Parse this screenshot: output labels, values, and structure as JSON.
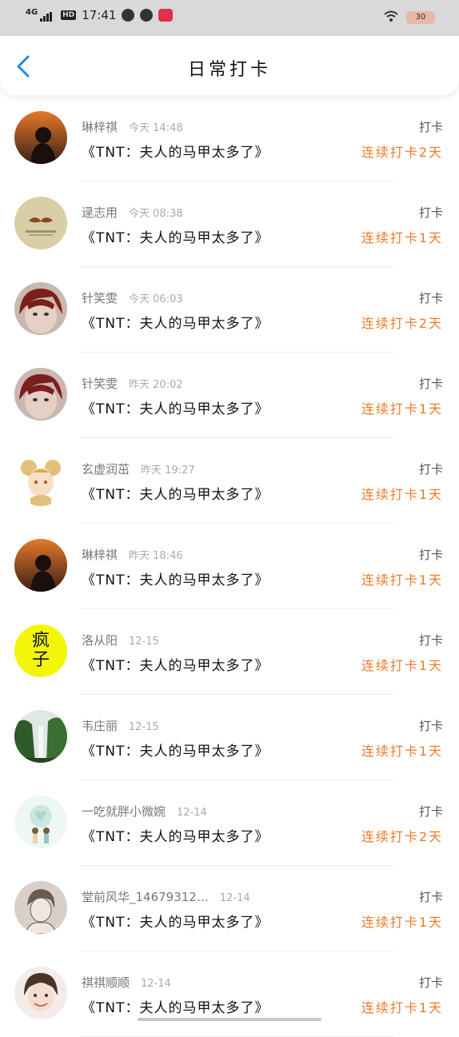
{
  "status_bar": {
    "network": "4G",
    "hd": "HD",
    "time": "17:41",
    "battery": "30"
  },
  "header": {
    "title": "日常打卡",
    "back_icon": "chevron-left-icon"
  },
  "colors": {
    "accent": "#1e88e5",
    "streak": "#f07a28"
  },
  "entries": [
    {
      "name": "琳梓祺",
      "time": "今天 14:48",
      "book": "《TNT：夫人的马甲太多了》",
      "label": "打卡",
      "streak": "连续打卡2天"
    },
    {
      "name": "逯志用",
      "time": "今天 08:38",
      "book": "《TNT：夫人的马甲太多了》",
      "label": "打卡",
      "streak": "连续打卡1天"
    },
    {
      "name": "针笑雯",
      "time": "今天 06:03",
      "book": "《TNT：夫人的马甲太多了》",
      "label": "打卡",
      "streak": "连续打卡2天"
    },
    {
      "name": "针笑雯",
      "time": "昨天 20:02",
      "book": "《TNT：夫人的马甲太多了》",
      "label": "打卡",
      "streak": "连续打卡1天"
    },
    {
      "name": "玄虚润茁",
      "time": "昨天 19:27",
      "book": "《TNT：夫人的马甲太多了》",
      "label": "打卡",
      "streak": "连续打卡1天"
    },
    {
      "name": "琳梓祺",
      "time": "昨天 18:46",
      "book": "《TNT：夫人的马甲太多了》",
      "label": "打卡",
      "streak": "连续打卡1天"
    },
    {
      "name": "洛从阳",
      "time": "12-15",
      "book": "《TNT：夫人的马甲太多了》",
      "label": "打卡",
      "streak": "连续打卡1天"
    },
    {
      "name": "韦庄丽",
      "time": "12-15",
      "book": "《TNT：夫人的马甲太多了》",
      "label": "打卡",
      "streak": "连续打卡1天"
    },
    {
      "name": "一吃就胖小微婉",
      "time": "12-14",
      "book": "《TNT：夫人的马甲太多了》",
      "label": "打卡",
      "streak": "连续打卡2天"
    },
    {
      "name": "堂前风华_14679312…",
      "time": "12-14",
      "book": "《TNT：夫人的马甲太多了》",
      "label": "打卡",
      "streak": "连续打卡1天"
    },
    {
      "name": "祺祺顺顺",
      "time": "12-14",
      "book": "《TNT：夫人的马甲太多了》",
      "label": "打卡",
      "streak": "连续打卡1天"
    }
  ],
  "avatar_text": {
    "fengzi": "疯子"
  }
}
